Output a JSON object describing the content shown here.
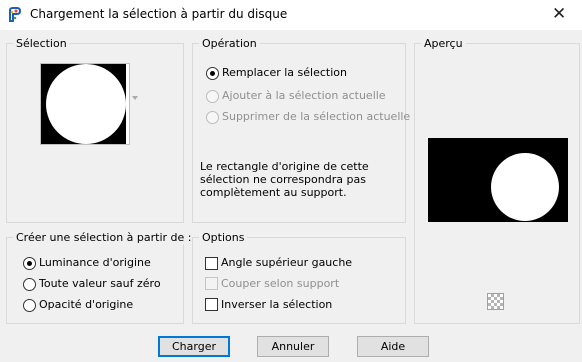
{
  "window": {
    "title": "Chargement la sélection à partir du disque",
    "close_glyph": "✕"
  },
  "selection_group": {
    "legend": "Sélection"
  },
  "operation_group": {
    "legend": "Opération",
    "options": [
      {
        "label": "Remplacer la sélection",
        "checked": true,
        "enabled": true
      },
      {
        "label": "Ajouter à la sélection actuelle",
        "checked": false,
        "enabled": false
      },
      {
        "label": "Supprimer de la sélection actuelle",
        "checked": false,
        "enabled": false
      }
    ],
    "notice_lines": [
      "Le rectangle d'origine de cette",
      "sélection ne correspondra pas",
      "complètement au support."
    ]
  },
  "preview_group": {
    "legend": "Aperçu"
  },
  "create_group": {
    "legend": "Créer une sélection à partir de :",
    "options": [
      {
        "label": "Luminance d'origine",
        "checked": true
      },
      {
        "label": "Toute valeur sauf zéro",
        "checked": false
      },
      {
        "label": "Opacité d'origine",
        "checked": false
      }
    ]
  },
  "options_group": {
    "legend": "Options",
    "checkboxes": [
      {
        "label": "Angle supérieur gauche",
        "checked": false,
        "enabled": true
      },
      {
        "label": "Couper selon support",
        "checked": false,
        "enabled": false
      },
      {
        "label": "Inverser la sélection",
        "checked": false,
        "enabled": true
      }
    ]
  },
  "buttons": {
    "ok": "Charger",
    "cancel": "Annuler",
    "help": "Aide"
  },
  "colors": {
    "accent": "#0078d7",
    "dialog_bg": "#f0f0f0",
    "group_border": "#d9d9d9"
  },
  "icons": {
    "app": "paint-palette-icon",
    "close": "close-icon",
    "dropdown": "chevron-down-icon",
    "transparency": "checkerboard-icon"
  }
}
